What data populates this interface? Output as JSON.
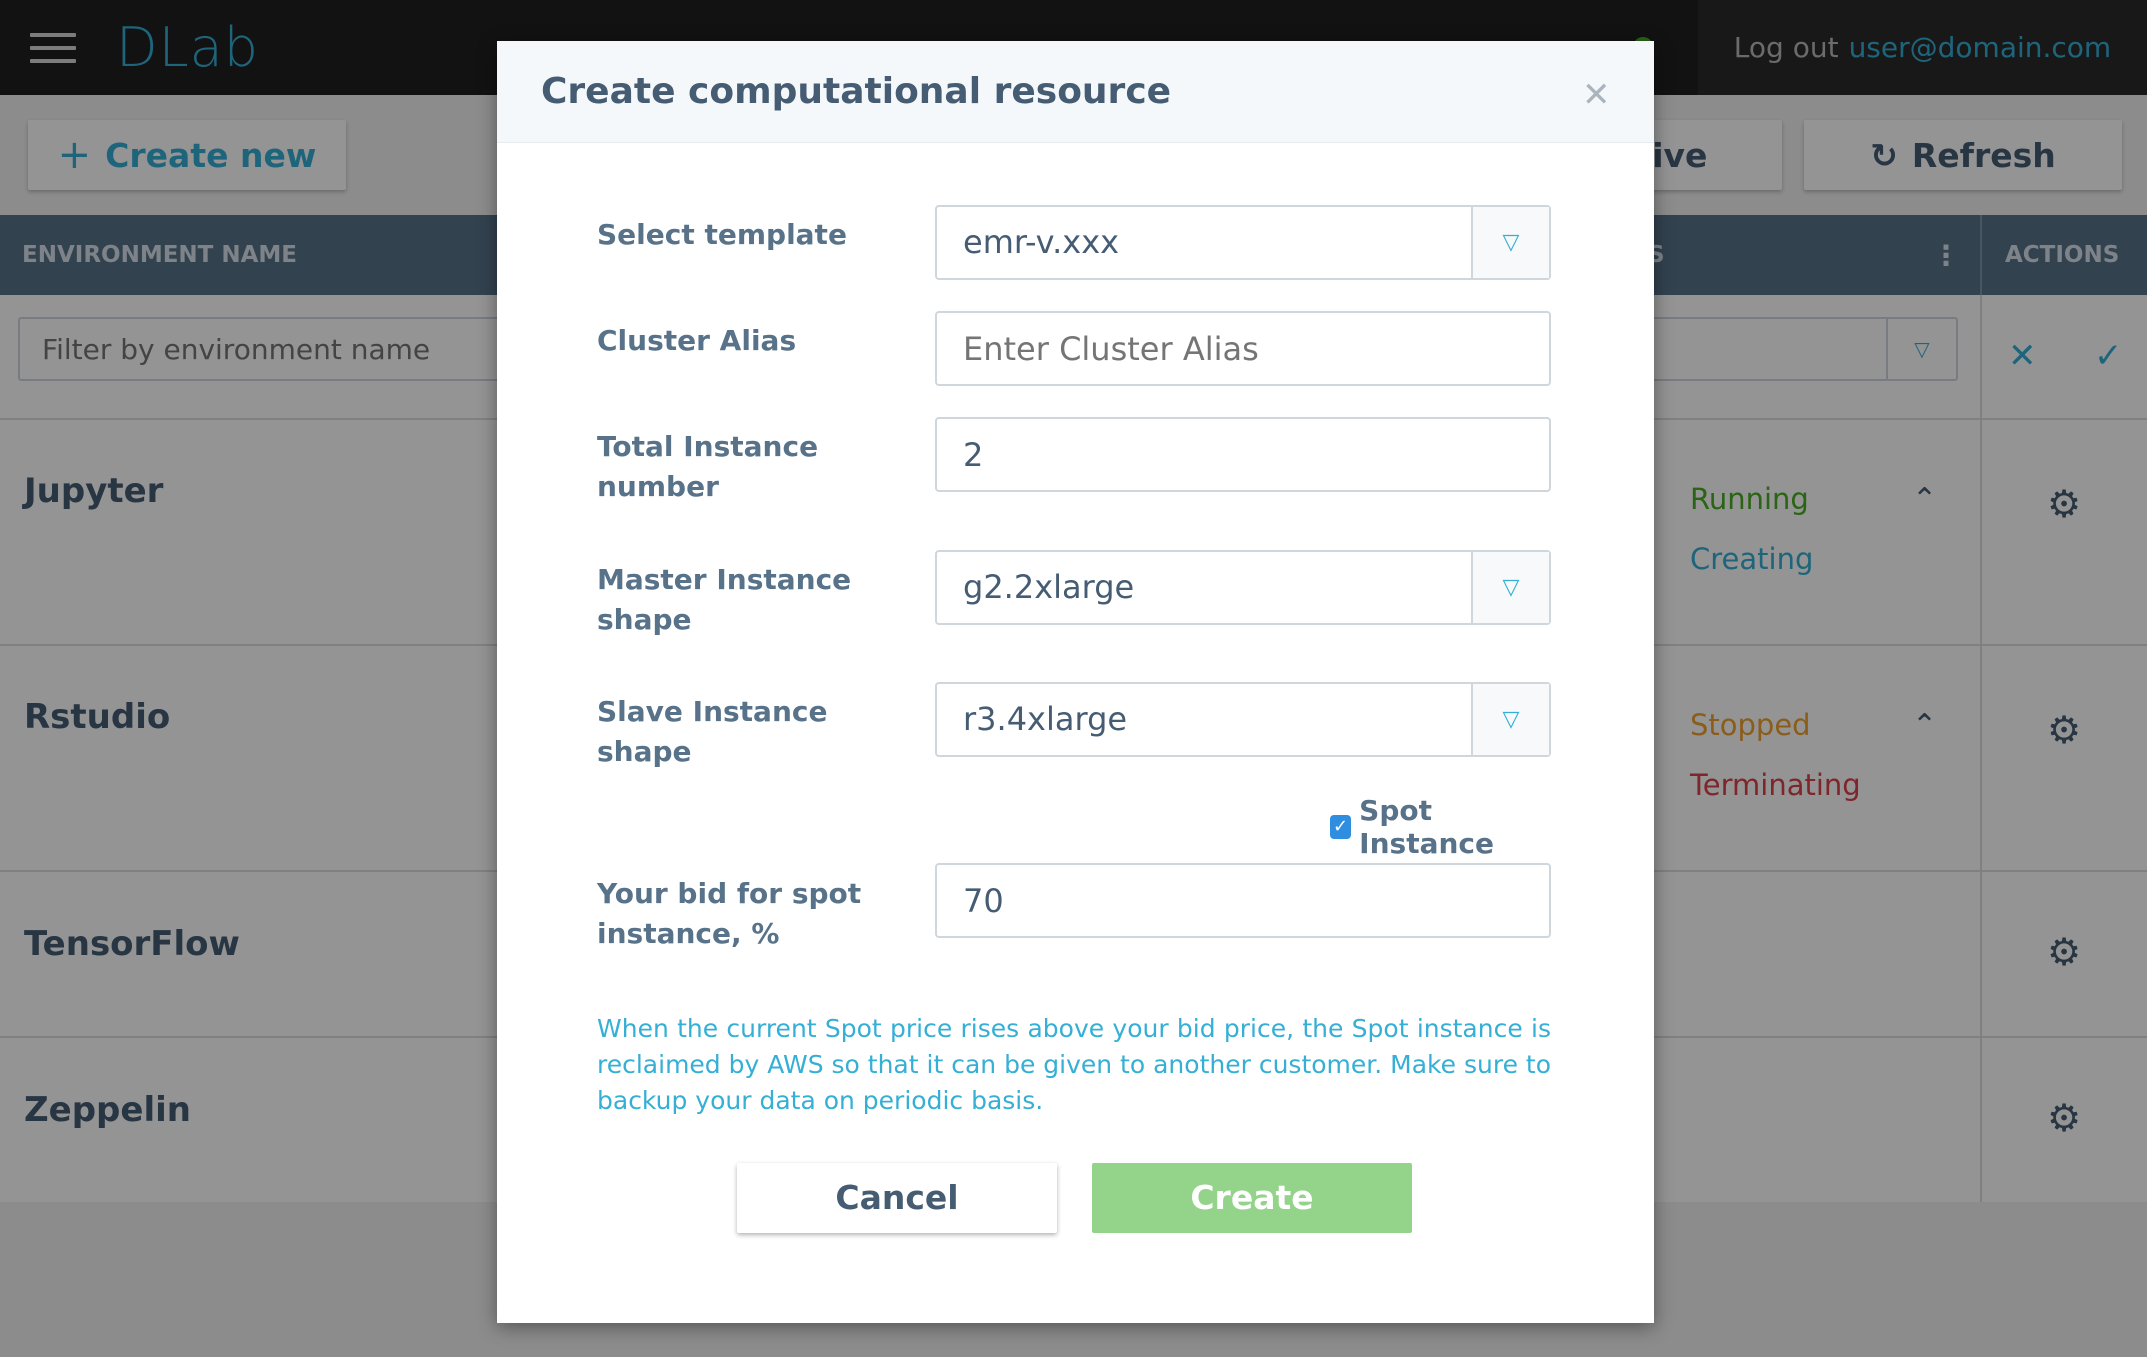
{
  "app": {
    "logo": "DLab",
    "logout_label": "Log out",
    "user_email": "user@domain.com"
  },
  "toolbar": {
    "create_new_label": "Create new",
    "active_label": "active",
    "refresh_label": "Refresh"
  },
  "table": {
    "headers": {
      "environment_name": "ENVIRONMENT NAME",
      "status_fragment": "S",
      "actions": "ACTIONS"
    },
    "filter_placeholder": "Filter by environment name",
    "rows": [
      {
        "name": "Jupyter",
        "statuses": [
          "Running",
          "Creating"
        ]
      },
      {
        "name": "Rstudio",
        "statuses": [
          "Stopped",
          "Terminating"
        ]
      },
      {
        "name": "TensorFlow",
        "statuses": []
      },
      {
        "name": "Zeppelin",
        "statuses": []
      }
    ]
  },
  "modal": {
    "title": "Create computational resource",
    "fields": {
      "template": {
        "label": "Select template",
        "value": "emr-v.xxx"
      },
      "cluster_alias": {
        "label": "Cluster Alias",
        "placeholder": "Enter Cluster Alias"
      },
      "total_instance": {
        "label": "Total Instance number",
        "value": "2"
      },
      "master_shape": {
        "label": "Master Instance shape",
        "value": "g2.2xlarge"
      },
      "slave_shape": {
        "label": "Slave Instance shape",
        "value": "r3.4xlarge"
      },
      "spot_instance": {
        "label": "Spot Instance",
        "checked": true
      },
      "bid": {
        "label": "Your bid for spot instance, %",
        "value": "70"
      }
    },
    "notice": "When the current Spot price rises above your bid price, the Spot instance is reclaimed by AWS so that it can be given to another customer. Make sure to backup your data on periodic basis.",
    "cancel_label": "Cancel",
    "create_label": "Create"
  },
  "colors": {
    "accent": "#35afd5",
    "running": "#49af25",
    "creating": "#35afd5",
    "stopped": "#f0a030",
    "terminating": "#d9434b",
    "create_button": "#93d38a"
  }
}
